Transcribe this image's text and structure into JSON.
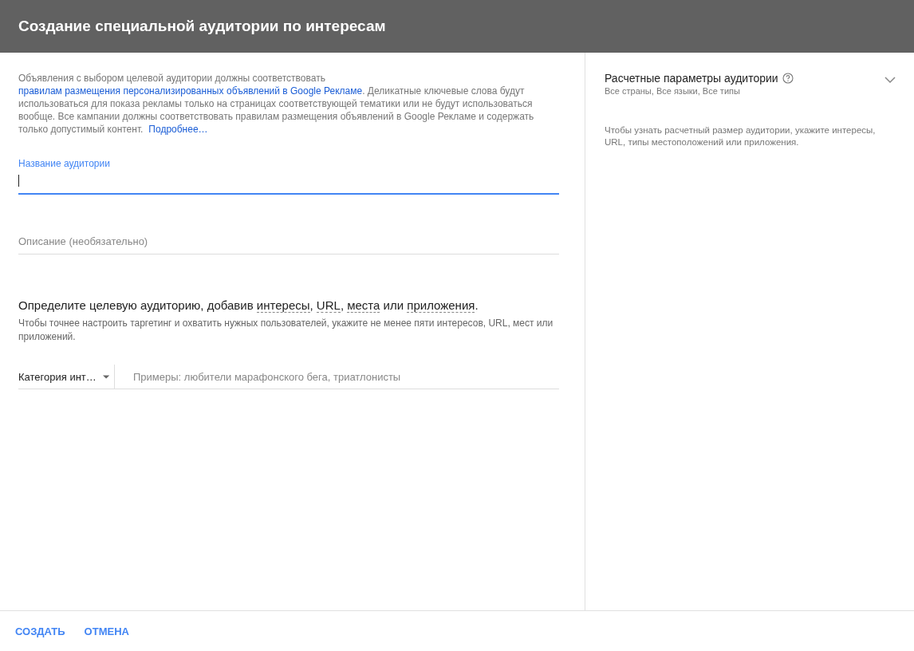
{
  "window": {
    "title": "Создание специальной аудитории по интересам"
  },
  "notice": [
    {
      "kind": "text",
      "text": "Объявления с выбором целевой аудитории должны соответствовать "
    },
    {
      "kind": "link",
      "text": "правилам размещения персонализированных"
    },
    {
      "kind": "link",
      "text": "объявлений в Google Рекламе"
    },
    {
      "kind": "text",
      "text": ". Деликатные ключевые слова будут использоваться для показа рекламы только на страницах соответствующей тематики или не будут использоваться вообще. Все кампании должны соответствовать правилам размещения объявлений в Google Рекламе и содержать только допустимый контент. "
    },
    {
      "kind": "link",
      "text": "Подробнее…"
    }
  ],
  "name_field": {
    "label": "Название аудитории",
    "focused": true
  },
  "description_field": {
    "placeholder": "Описание (необязательно)",
    "focused": false
  },
  "targeting": {
    "heading": [
      {
        "kind": "text",
        "text": "Определите целевую аудиторию, добавив "
      },
      {
        "kind": "term",
        "text": "интересы"
      },
      {
        "kind": "text",
        "text": ", "
      },
      {
        "kind": "term",
        "text": "URL"
      },
      {
        "kind": "text",
        "text": ", "
      },
      {
        "kind": "term",
        "text": "места"
      },
      {
        "kind": "text",
        "text": " или "
      },
      {
        "kind": "term",
        "text": "приложения"
      },
      {
        "kind": "text",
        "text": "."
      }
    ],
    "hint": "Чтобы точнее настроить таргетинг и охватить нужных пользователей, укажите не менее пяти интересов, URL, мест или приложений.",
    "category": "Категория инт…",
    "search_placeholder": "Примеры: любители марафонского бега, триатлонисты"
  },
  "estimate": {
    "title": "Расчетные параметры аудитории",
    "subtitle": "Все страны, Все языки, Все типы",
    "expanded": false,
    "hint": "Чтобы узнать расчетный размер аудитории, укажите интересы, URL, типы местоположений или приложения."
  },
  "buttons": [
    "СОЗДАТЬ",
    "ОТМЕНА"
  ]
}
